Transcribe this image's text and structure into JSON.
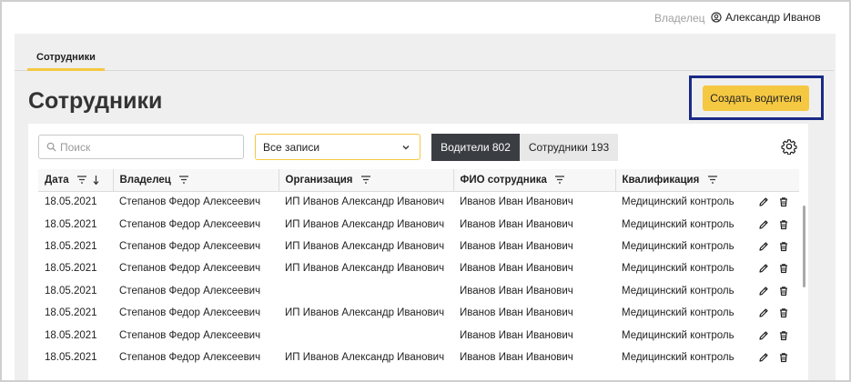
{
  "topbar": {
    "owner_label": "Владелец",
    "user_name": "Александр Иванов"
  },
  "tabs": [
    {
      "label": "Сотрудники",
      "active": true
    }
  ],
  "page": {
    "title": "Сотрудники",
    "create_button": "Создать водителя"
  },
  "filters": {
    "search_placeholder": "Поиск",
    "select_value": "Все записи",
    "segments": [
      {
        "label": "Водители 802",
        "active": true
      },
      {
        "label": "Сотрудники 193",
        "active": false
      }
    ]
  },
  "table": {
    "columns": [
      "Дата",
      "Владелец",
      "Организация",
      "ФИО сотрудника",
      "Квалификация"
    ],
    "rows": [
      [
        "18.05.2021",
        "Степанов Федор Алексеевич",
        "ИП Иванов Александр Иванович",
        "Иванов Иван Иванович",
        "Медицинский контроль"
      ],
      [
        "18.05.2021",
        "Степанов Федор Алексеевич",
        "ИП Иванов Александр Иванович",
        "Иванов Иван Иванович",
        "Медицинский контроль"
      ],
      [
        "18.05.2021",
        "Степанов Федор Алексеевич",
        "ИП Иванов Александр Иванович",
        "Иванов Иван Иванович",
        "Медицинский контроль"
      ],
      [
        "18.05.2021",
        "Степанов Федор Алексеевич",
        "ИП Иванов Александр Иванович",
        "Иванов Иван Иванович",
        "Медицинский контроль"
      ],
      [
        "18.05.2021",
        "Степанов Федор Алексеевич",
        "",
        "Иванов Иван Иванович",
        "Медицинский контроль"
      ],
      [
        "18.05.2021",
        "Степанов Федор Алексеевич",
        "ИП Иванов Александр Иванович",
        "Иванов Иван Иванович",
        "Медицинский контроль"
      ],
      [
        "18.05.2021",
        "Степанов Федор Алексеевич",
        "",
        "Иванов Иван Иванович",
        "Медицинский контроль"
      ],
      [
        "18.05.2021",
        "Степанов Федор Алексеевич",
        "ИП Иванов Александр Иванович",
        "Иванов Иван Иванович",
        "Медицинский контроль"
      ]
    ]
  },
  "icons": {
    "user": "user-location-icon",
    "search": "search-icon",
    "dropdown": "chevron-down-icon",
    "settings": "gear-icon",
    "filter": "filter-icon",
    "sort": "sort-arrow-icon",
    "edit": "pencil-icon",
    "delete": "trash-icon"
  },
  "colors": {
    "accent": "#f5c842",
    "segment_active": "#3a3d42",
    "highlight_border": "#1a2a86"
  }
}
